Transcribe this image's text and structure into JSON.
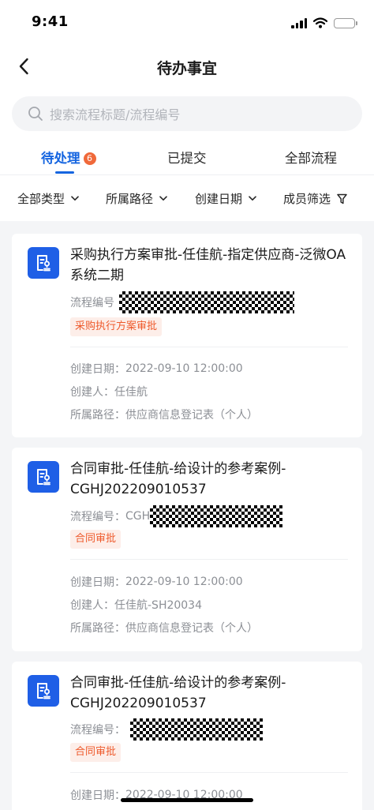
{
  "status_bar": {
    "time": "9:41"
  },
  "nav": {
    "title": "待办事宜"
  },
  "search": {
    "placeholder": "搜索流程标题/流程编号"
  },
  "tabs": [
    {
      "label": "待处理",
      "badge": "6",
      "active": true
    },
    {
      "label": "已提交",
      "active": false
    },
    {
      "label": "全部流程",
      "active": false
    }
  ],
  "filters": [
    {
      "label": "全部类型"
    },
    {
      "label": "所属路径"
    },
    {
      "label": "创建日期"
    },
    {
      "label": "成员筛选"
    }
  ],
  "cards": [
    {
      "title": "采购执行方案审批-任佳航-指定供应商-泛微OA系统二期",
      "process_no_label": "流程编号",
      "process_no_prefix": "",
      "tag": "采购执行方案审批",
      "created_date_label": "创建日期：",
      "created_date": "2022-09-10 12:00:00",
      "creator_label": "创建人：",
      "creator": "任佳航",
      "path_label": "所属路径：",
      "path": "供应商信息登记表（个人）"
    },
    {
      "title": "合同审批-任佳航-给设计的参考案例-CGHJ202209010537",
      "process_no_label": "流程编号：",
      "process_no_prefix": "CGH",
      "tag": "合同审批",
      "created_date_label": "创建日期：",
      "created_date": "2022-09-10 12:00:00",
      "creator_label": "创建人：",
      "creator": "任佳航-SH20034",
      "path_label": "所属路径：",
      "path": "供应商信息登记表（个人）"
    },
    {
      "title": "合同审批-任佳航-给设计的参考案例-CGHJ202209010537",
      "process_no_label": "流程编号：",
      "process_no_prefix": "",
      "tag": "合同审批",
      "created_date_label": "创建日期：",
      "created_date": "2022-09-10 12:00:00"
    }
  ],
  "colors": {
    "accent": "#1565e0",
    "badge": "#f0693a",
    "tag_text": "#ee5a2c",
    "tag_bg": "#fdeee9",
    "icon_bg": "#1f5fe6"
  }
}
